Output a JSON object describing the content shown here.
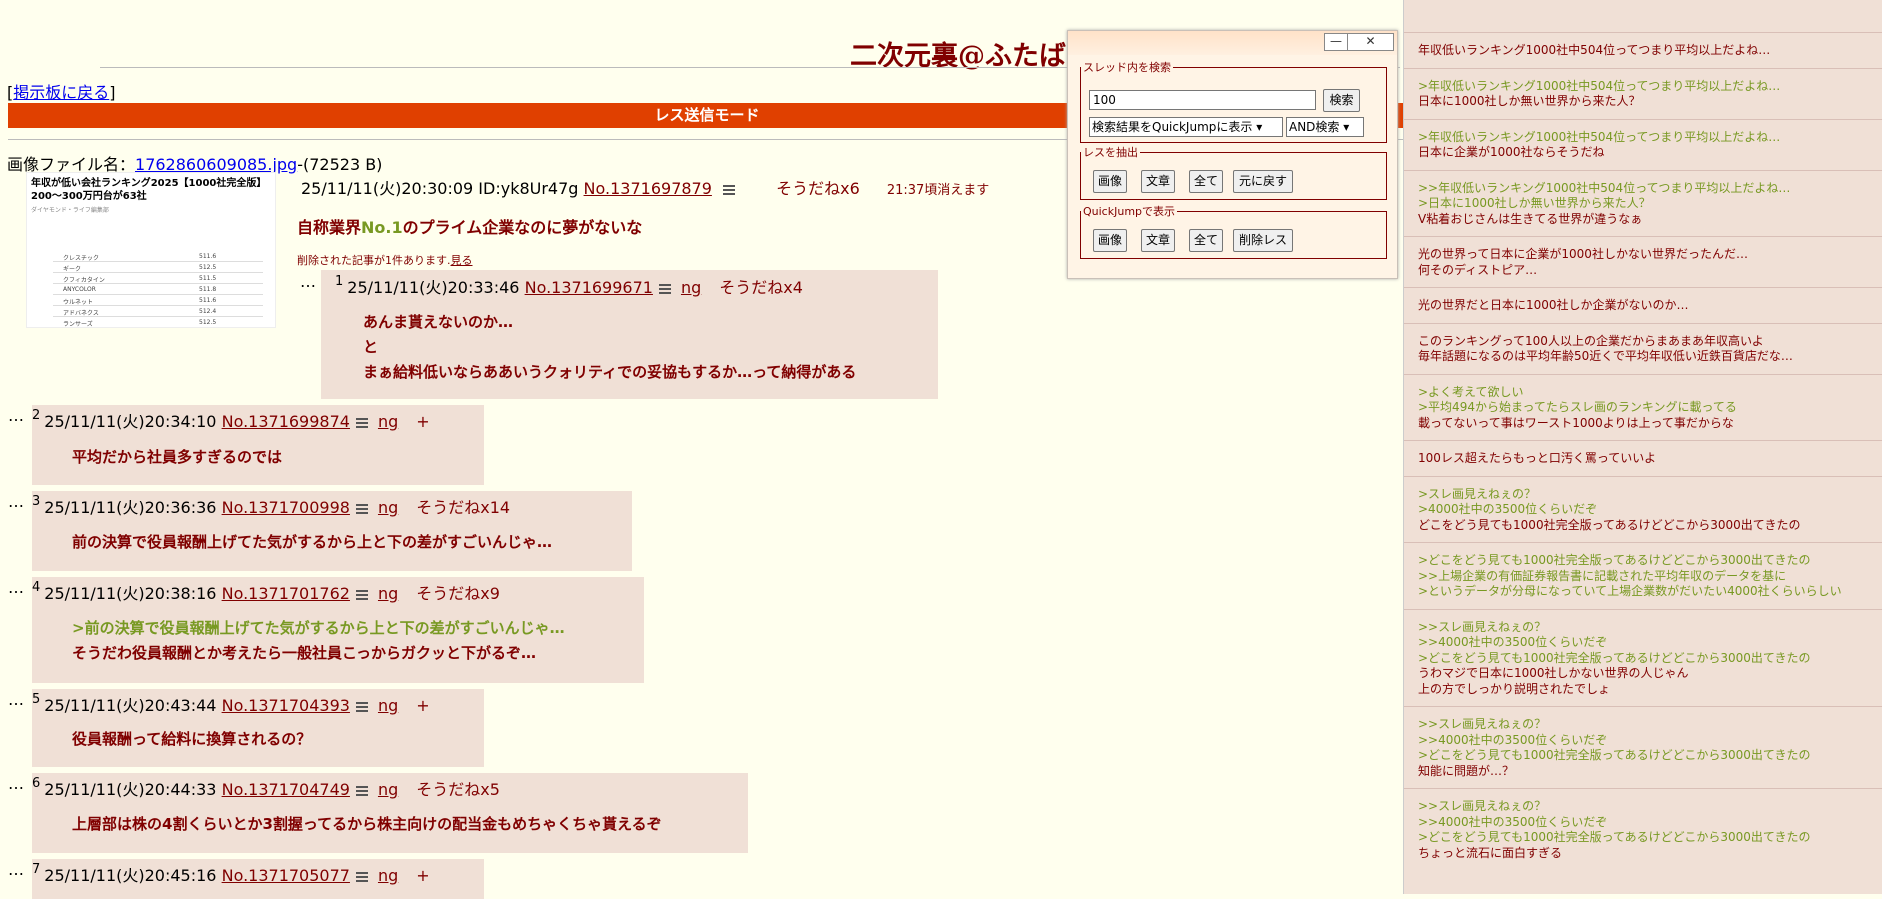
{
  "board_title": "二次元裏@ふたば",
  "back_link": {
    "prefix": "[",
    "label": "掲示板に戻る",
    "suffix": "]"
  },
  "mode_bar": "レス送信モード",
  "file": {
    "label": "画像ファイル名：",
    "name": "1762860609085.jpg",
    "suffix": "-(72523 B)"
  },
  "thumbnail": {
    "title": "年収が低い会社ランキング2025【1000社完全版】200～300万円台が63社",
    "source": "ダイヤモンド・ライフ編集部",
    "rows": [
      {
        "name": "クレスチック",
        "val": "511.6"
      },
      {
        "name": "ギーク",
        "val": "512.5"
      },
      {
        "name": "クフィカタイン",
        "val": "511.5"
      },
      {
        "name": "ANYCOLOR",
        "val": "511.8"
      },
      {
        "name": "ウルネット",
        "val": "511.6"
      },
      {
        "name": "アドバネクス",
        "val": "512.4"
      },
      {
        "name": "ランサーズ",
        "val": "512.5"
      }
    ]
  },
  "op": {
    "datetime": "25/11/11(火)20:30:09 ID:yk8Ur47g",
    "no": "No.1371697879",
    "sodane": "そうだねx6",
    "expire": "21:37頃消えます",
    "body_prefix": "自称業界",
    "body_highlight": "No.1",
    "body_suffix": "のプライム企業なのに夢がないな",
    "deleted_note": "削除された記事が1件あります.",
    "deleted_link": "見る"
  },
  "replies": [
    {
      "num": "1",
      "datetime": "25/11/11(火)20:33:46",
      "no": "No.1371699671",
      "ng": "ng",
      "sodane": "そうだねx4",
      "lines": [
        "あんま貰えないのか…",
        "と",
        "まぁ給料低いならああいうクォリティでの妥協もするか…って納得がある"
      ]
    },
    {
      "num": "2",
      "datetime": "25/11/11(火)20:34:10",
      "no": "No.1371699874",
      "ng": "ng",
      "sodane": "+",
      "lines": [
        "平均だから社員多すぎるのでは"
      ]
    },
    {
      "num": "3",
      "datetime": "25/11/11(火)20:36:36",
      "no": "No.1371700998",
      "ng": "ng",
      "sodane": "そうだねx14",
      "lines": [
        "前の決算で役員報酬上げてた気がするから上と下の差がすごいんじゃ…"
      ]
    },
    {
      "num": "4",
      "datetime": "25/11/11(火)20:38:16",
      "no": "No.1371701762",
      "ng": "ng",
      "sodane": "そうだねx9",
      "quote": ">前の決算で役員報酬上げてた気がするから上と下の差がすごいんじゃ…",
      "lines": [
        "そうだわ役員報酬とか考えたら一般社員こっからガクッと下がるぞ…"
      ]
    },
    {
      "num": "5",
      "datetime": "25/11/11(火)20:43:44",
      "no": "No.1371704393",
      "ng": "ng",
      "sodane": "+",
      "lines": [
        "役員報酬って給料に換算されるの？"
      ]
    },
    {
      "num": "6",
      "datetime": "25/11/11(火)20:44:33",
      "no": "No.1371704749",
      "ng": "ng",
      "sodane": "そうだねx5",
      "lines": [
        "上層部は株の4割くらいとか3割握ってるから株主向けの配当金もめちゃくちゃ貰えるぞ"
      ]
    },
    {
      "num": "7",
      "datetime": "25/11/11(火)20:45:16",
      "no": "No.1371705077",
      "ng": "ng",
      "sodane": "+",
      "lines": []
    }
  ],
  "dots": "…",
  "search_window": {
    "minimize": "—",
    "close": "✕",
    "section1": "スレッド内を検索",
    "query": "100",
    "search_btn": "検索",
    "select1": "検索結果をQuickJumpに表示",
    "select2": "AND検索",
    "section2": "レスを抽出",
    "extract_buttons": [
      "画像",
      "文章",
      "全て",
      "元に戻す"
    ],
    "section3": "QuickJumpで表示",
    "qj_buttons": [
      "画像",
      "文章",
      "全て",
      "削除レス"
    ]
  },
  "quickjump": [
    {
      "lines": [
        {
          "t": "年収低いランキング1000社中504位ってつまり平均以上だよね…",
          "q": false
        }
      ]
    },
    {
      "lines": [
        {
          "t": ">年収低いランキング1000社中504位ってつまり平均以上だよね…",
          "q": true
        },
        {
          "t": "日本に1000社しか無い世界から来た人？",
          "q": false
        }
      ]
    },
    {
      "lines": [
        {
          "t": ">年収低いランキング1000社中504位ってつまり平均以上だよね…",
          "q": true
        },
        {
          "t": "日本に企業が1000社ならそうだね",
          "q": false
        }
      ]
    },
    {
      "lines": [
        {
          "t": ">>年収低いランキング1000社中504位ってつまり平均以上だよね…",
          "q": true
        },
        {
          "t": ">日本に1000社しか無い世界から来た人？",
          "q": true
        },
        {
          "t": "V粘着おじさんは生きてる世界が違うなぁ",
          "q": false
        }
      ]
    },
    {
      "lines": [
        {
          "t": "光の世界って日本に企業が1000社しかない世界だったんだ…",
          "q": false
        },
        {
          "t": "何そのディストピア…",
          "q": false
        }
      ]
    },
    {
      "lines": [
        {
          "t": "光の世界だと日本に1000社しか企業がないのか…",
          "q": false
        }
      ]
    },
    {
      "lines": [
        {
          "t": "このランキングって100人以上の企業だからまあまあ年収高いよ",
          "q": false
        },
        {
          "t": "毎年話題になるのは平均年齢50近くで平均年収低い近鉄百貨店だな…",
          "q": false
        }
      ]
    },
    {
      "lines": [
        {
          "t": ">よく考えて欲しい",
          "q": true
        },
        {
          "t": ">平均494から始まってたらスレ画のランキングに載ってる",
          "q": true
        },
        {
          "t": "載ってないって事はワースト1000よりは上って事だからな",
          "q": false
        }
      ]
    },
    {
      "lines": [
        {
          "t": "100レス超えたらもっと口汚く罵っていいよ",
          "q": false
        }
      ]
    },
    {
      "lines": [
        {
          "t": ">スレ画見えねぇの？",
          "q": true
        },
        {
          "t": ">4000社中の3500位くらいだぞ",
          "q": true
        },
        {
          "t": "どこをどう見ても1000社完全版ってあるけどどこから3000出てきたの",
          "q": false
        }
      ]
    },
    {
      "lines": [
        {
          "t": ">どこをどう見ても1000社完全版ってあるけどどこから3000出てきたの",
          "q": true
        },
        {
          "t": ">>上場企業の有価証券報告書に記載された平均年収のデータを基に",
          "q": true
        },
        {
          "t": ">というデータが分母になっていて上場企業数がだいたい4000社くらいらしい",
          "q": true
        }
      ]
    },
    {
      "lines": [
        {
          "t": ">>スレ画見えねぇの？",
          "q": true
        },
        {
          "t": ">>4000社中の3500位くらいだぞ",
          "q": true
        },
        {
          "t": ">どこをどう見ても1000社完全版ってあるけどどこから3000出てきたの",
          "q": true
        },
        {
          "t": "うわマジで日本に1000社しかない世界の人じゃん",
          "q": false
        },
        {
          "t": "上の方でしっかり説明されたでしょ",
          "q": false
        }
      ]
    },
    {
      "lines": [
        {
          "t": ">>スレ画見えねぇの？",
          "q": true
        },
        {
          "t": ">>4000社中の3500位くらいだぞ",
          "q": true
        },
        {
          "t": ">どこをどう見ても1000社完全版ってあるけどどこから3000出てきたの",
          "q": true
        },
        {
          "t": "知能に問題が…？",
          "q": false
        }
      ]
    },
    {
      "lines": [
        {
          "t": ">>スレ画見えねぇの？",
          "q": true
        },
        {
          "t": ">>4000社中の3500位くらいだぞ",
          "q": true
        },
        {
          "t": ">どこをどう見ても1000社完全版ってあるけどどこから3000出てきたの",
          "q": true
        },
        {
          "t": "ちょっと流石に面白すぎる",
          "q": false
        }
      ]
    }
  ]
}
